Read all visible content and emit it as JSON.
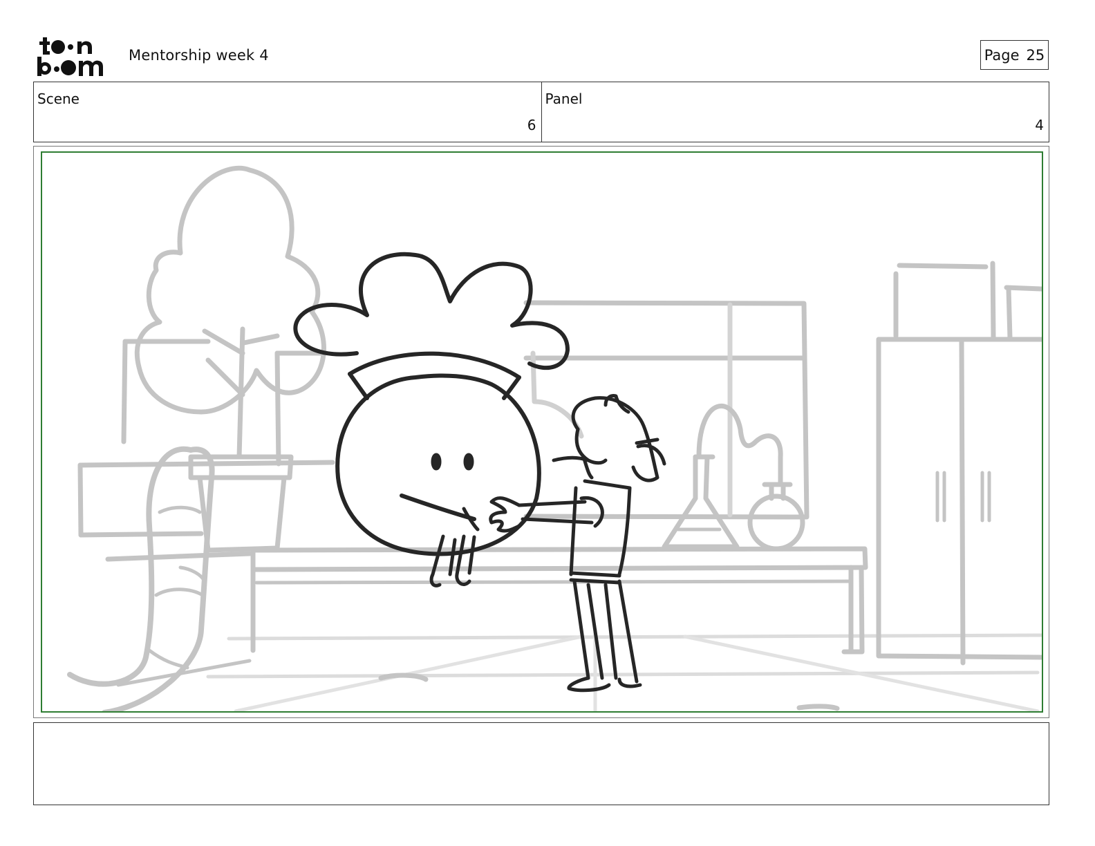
{
  "header": {
    "logo_text": "toon boom",
    "document_title": "Mentorship week 4",
    "page_label": "Page",
    "page_number": "25"
  },
  "info": {
    "scene_label": "Scene",
    "scene_value": "6",
    "panel_label": "Panel",
    "panel_value": "4"
  },
  "notes": {
    "text": ""
  },
  "colors": {
    "frame_border": "#2e7d32",
    "sketch_background": "#c4c4c4",
    "sketch_foreground": "#262626"
  }
}
